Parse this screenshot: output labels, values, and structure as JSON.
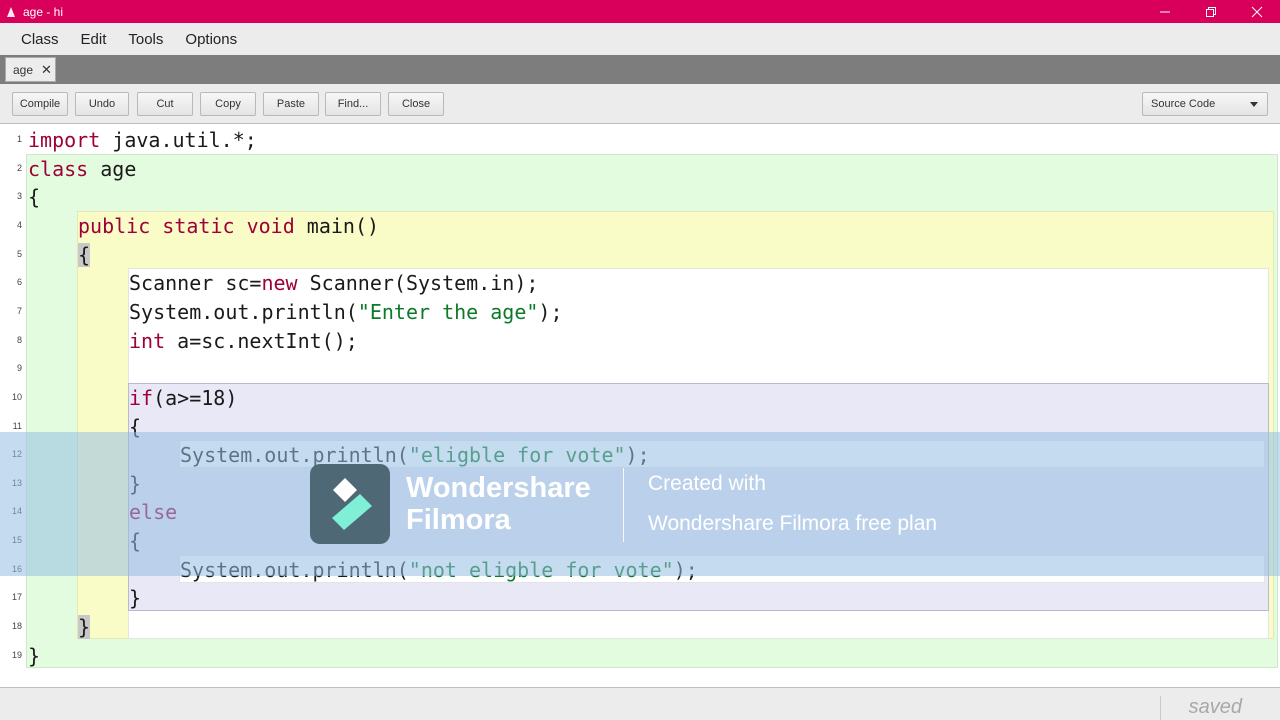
{
  "window": {
    "title": "age - hi"
  },
  "menu": [
    "Class",
    "Edit",
    "Tools",
    "Options"
  ],
  "tabs": [
    {
      "label": "age"
    }
  ],
  "toolbar": {
    "buttons": [
      "Compile",
      "Undo",
      "Cut",
      "Copy",
      "Paste",
      "Find...",
      "Close"
    ],
    "view_select": "Source Code"
  },
  "editor": {
    "lines": [
      [
        [
          "kw",
          "import"
        ],
        [
          "",
          "java.util.*;"
        ]
      ],
      [
        [
          "kw",
          "class"
        ],
        [
          "",
          "age"
        ]
      ],
      [
        [
          "",
          "{"
        ]
      ],
      [
        [
          "kw",
          "public static void"
        ],
        [
          "",
          "main()"
        ]
      ],
      [
        [
          "hl",
          "{"
        ]
      ],
      [
        [
          "",
          "Scanner sc="
        ],
        [
          "kw",
          "new"
        ],
        [
          "",
          "Scanner(System.in);"
        ]
      ],
      [
        [
          "",
          "System.out.println("
        ],
        [
          "str",
          "\"Enter the age\""
        ],
        [
          "",
          ");"
        ]
      ],
      [
        [
          "kw",
          "int"
        ],
        [
          "",
          "a=sc.nextInt();"
        ]
      ],
      [],
      [
        [
          "kw",
          "if"
        ],
        [
          "",
          "(a>=18)"
        ]
      ],
      [
        [
          "",
          "{"
        ]
      ],
      [
        [
          "",
          "System.out.println("
        ],
        [
          "str",
          "\"eligble for vote\""
        ],
        [
          "",
          ");"
        ]
      ],
      [
        [
          "",
          "}"
        ]
      ],
      [
        [
          "kw",
          "else"
        ]
      ],
      [
        [
          "",
          "{"
        ]
      ],
      [
        [
          "",
          "System.out.println("
        ],
        [
          "str",
          "\"not eligble for vote\""
        ],
        [
          "",
          ");"
        ]
      ],
      [
        [
          "",
          "}"
        ]
      ],
      [
        [
          "hl",
          "}"
        ]
      ],
      [
        [
          "",
          "}"
        ]
      ]
    ]
  },
  "watermark": {
    "brand_line1": "Wondershare",
    "brand_line2": "Filmora",
    "text1": "Created with",
    "text2": "Wondershare Filmora free plan"
  },
  "status": {
    "text": "saved"
  }
}
